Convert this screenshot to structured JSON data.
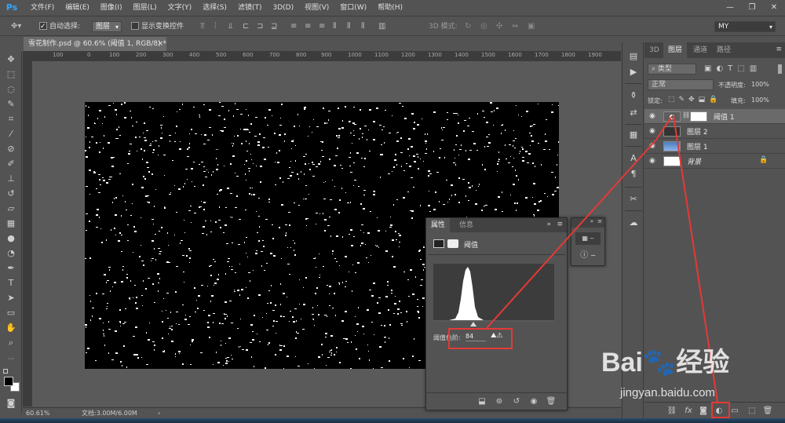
{
  "app": {
    "logo": "Ps"
  },
  "menu": [
    "文件(F)",
    "编辑(E)",
    "图像(I)",
    "图层(L)",
    "文字(Y)",
    "选择(S)",
    "滤镜(T)",
    "3D(D)",
    "视图(V)",
    "窗口(W)",
    "帮助(H)"
  ],
  "window_controls": {
    "minimize": "—",
    "restore": "❐",
    "close": "✕"
  },
  "options": {
    "auto_select_label": "自动选择:",
    "auto_select_value": "图层",
    "show_transform_label": "显示变换控件",
    "mode_3d_label": "3D 模式:",
    "workspace": "MY"
  },
  "document": {
    "tab_title": "雪花制作.psd @ 60.6% (阈值 1, RGB/8) *",
    "tab_close": "×",
    "zoom": "60.61%",
    "doc_info": "文档:3.00M/6.00M"
  },
  "ruler_labels": [
    "100",
    "0",
    "100",
    "200",
    "300",
    "400",
    "500",
    "600",
    "700",
    "800",
    "900",
    "1000",
    "1100",
    "1200",
    "1300",
    "1400",
    "1500",
    "1600",
    "1700",
    "1800",
    "1900"
  ],
  "layers_panel": {
    "tabs": [
      "3D",
      "图层",
      "通道",
      "路径"
    ],
    "active_tab": "图层",
    "filter_type": "类型",
    "blend_mode": "正常",
    "opacity_label": "不透明度:",
    "opacity_value": "100%",
    "lock_label": "锁定:",
    "fill_label": "填充:",
    "fill_value": "100%",
    "layers": [
      {
        "name": "阈值 1",
        "selected": true
      },
      {
        "name": "图层 2",
        "selected": false
      },
      {
        "name": "图层 1",
        "selected": false
      },
      {
        "name": "背景",
        "selected": false,
        "italic": true
      }
    ]
  },
  "properties_panel": {
    "tabs": [
      "属性",
      "信息"
    ],
    "active_tab": "属性",
    "adjustment_name": "阈值",
    "threshold_label": "阈值色阶:",
    "threshold_value": "84",
    "collapse": "»",
    "menu": "≡"
  },
  "watermark": {
    "brand_left": "Bai",
    "brand_right": "经验",
    "url": "jingyan.baidu.com"
  },
  "colors": {
    "highlight_red": "#e53935",
    "ps_blue": "#31a8ff"
  }
}
